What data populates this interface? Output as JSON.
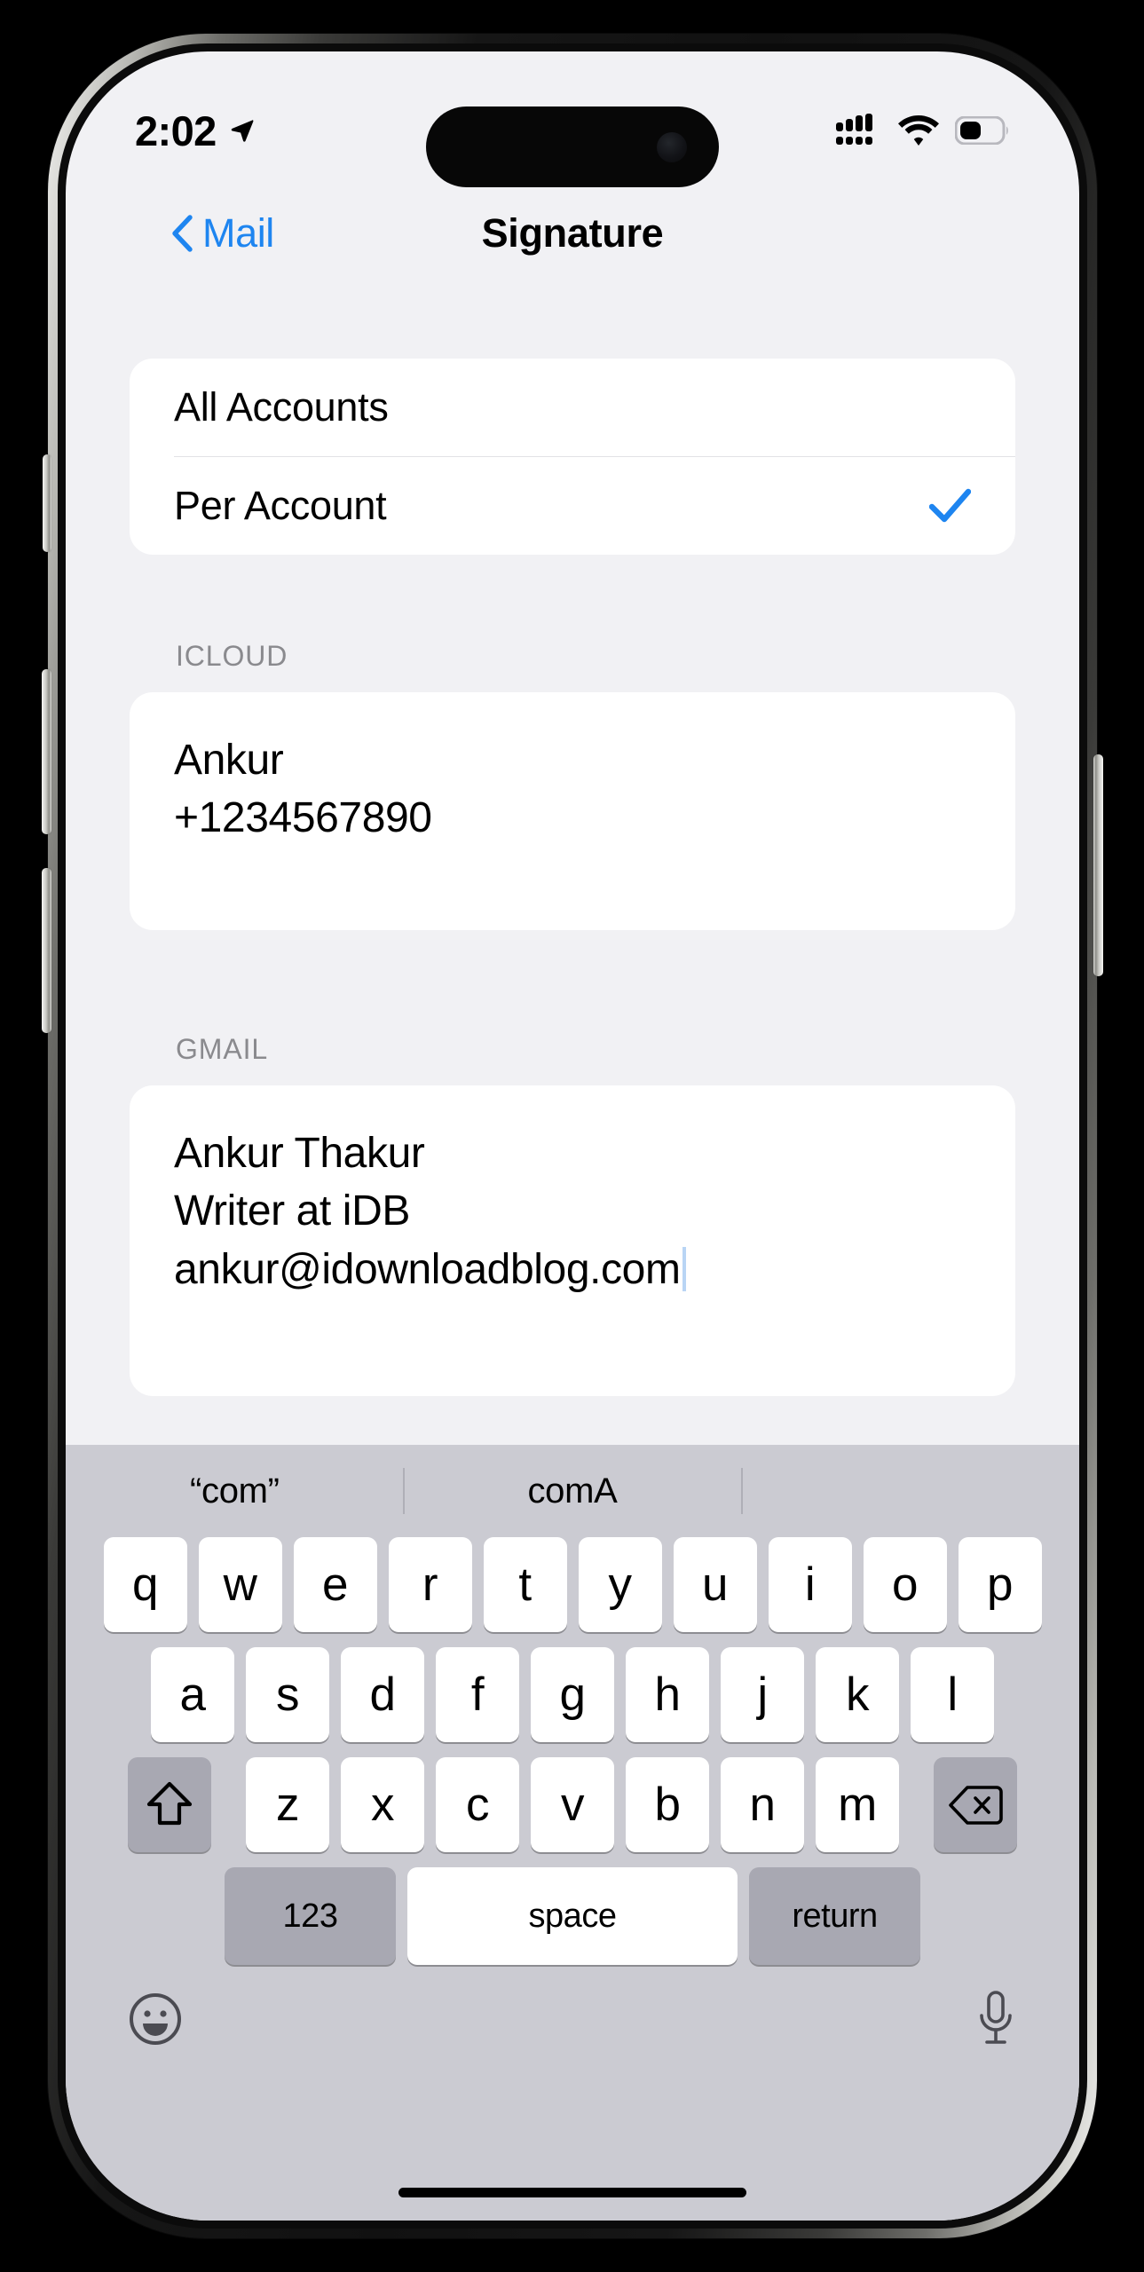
{
  "status_bar": {
    "time": "2:02",
    "location_icon": "location-arrow-icon",
    "cellular_icon": "cellular-signal-icon",
    "wifi_icon": "wifi-icon",
    "battery_icon": "battery-icon",
    "battery_level_percent": 42
  },
  "nav_bar": {
    "back_label": "Mail",
    "back_icon": "chevron-left-icon",
    "title": "Signature"
  },
  "scope_options": [
    {
      "label": "All Accounts",
      "selected": false
    },
    {
      "label": "Per Account",
      "selected": true
    }
  ],
  "check_icon": "checkmark-icon",
  "sections": [
    {
      "header": "ICLOUD",
      "lines": [
        "Ankur",
        "+1234567890"
      ],
      "has_caret": false
    },
    {
      "header": "GMAIL",
      "lines": [
        "Ankur Thakur",
        "Writer at iDB",
        "ankur@idownloadblog.com"
      ],
      "has_caret": true
    }
  ],
  "keyboard": {
    "suggestions": [
      "“com”",
      "comA",
      ""
    ],
    "row1": [
      "q",
      "w",
      "e",
      "r",
      "t",
      "y",
      "u",
      "i",
      "o",
      "p"
    ],
    "row2": [
      "a",
      "s",
      "d",
      "f",
      "g",
      "h",
      "j",
      "k",
      "l"
    ],
    "row3": [
      "z",
      "x",
      "c",
      "v",
      "b",
      "n",
      "m"
    ],
    "shift_icon": "shift-arrow-icon",
    "delete_icon": "delete-backward-icon",
    "numeric_label": "123",
    "space_label": "space",
    "return_label": "return",
    "emoji_icon": "emoji-smiley-icon",
    "dictation_icon": "microphone-icon"
  },
  "colors": {
    "accent_blue": "#1E85F0",
    "background": "#F1F1F4",
    "card": "#FFFFFF",
    "keyboard_bg": "#CBCBD2",
    "key_white": "#FFFFFF",
    "key_gray": "#A8A8B2",
    "section_header_gray": "#8A8A8E",
    "caret_blue": "#B9D5F5"
  }
}
